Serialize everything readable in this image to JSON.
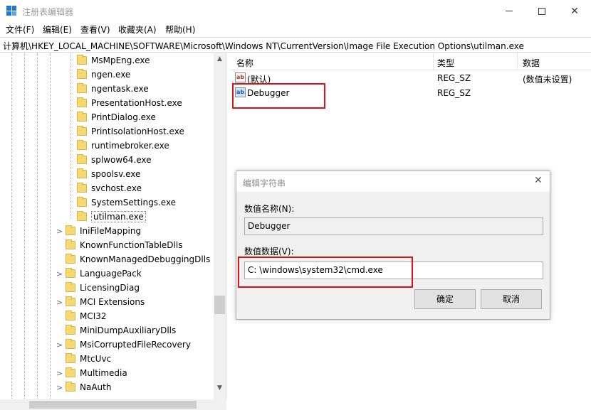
{
  "window": {
    "title": "注册表编辑器",
    "buttons": {
      "minimize": "—",
      "maximize": "☐",
      "close": "✕"
    }
  },
  "menu": [
    "文件(F)",
    "编辑(E)",
    "查看(V)",
    "收藏夹(A)",
    "帮助(H)"
  ],
  "address": "计算机\\HKEY_LOCAL_MACHINE\\SOFTWARE\\Microsoft\\Windows NT\\CurrentVersion\\Image File Execution Options\\utilman.exe",
  "tree": {
    "children": [
      "MsMpEng.exe",
      "ngen.exe",
      "ngentask.exe",
      "PresentationHost.exe",
      "PrintDialog.exe",
      "PrintIsolationHost.exe",
      "runtimebroker.exe",
      "splwow64.exe",
      "spoolsv.exe",
      "svchost.exe",
      "SystemSettings.exe",
      "utilman.exe"
    ],
    "selected": "utilman.exe",
    "siblings": [
      "IniFileMapping",
      "KnownFunctionTableDlls",
      "KnownManagedDebuggingDlls",
      "LanguagePack",
      "LicensingDiag",
      "MCI Extensions",
      "MCI32",
      "MiniDumpAuxiliaryDlls",
      "MsiCorruptedFileRecovery",
      "MtcUvc",
      "Multimedia",
      "NaAuth"
    ]
  },
  "list": {
    "headers": {
      "name": "名称",
      "type": "类型",
      "data": "数据"
    },
    "rows": [
      {
        "name": "(默认)",
        "type": "REG_SZ",
        "data": "(数值未设置)"
      },
      {
        "name": "Debugger",
        "type": "REG_SZ",
        "data": ""
      }
    ]
  },
  "dialog": {
    "title": "编辑字符串",
    "close": "✕",
    "name_label": "数值名称(N):",
    "name_value": "Debugger",
    "data_label": "数值数据(V):",
    "data_value": "C:  \\windows\\system32\\cmd.exe",
    "ok": "确定",
    "cancel": "取消"
  },
  "colors": {
    "highlight": "#e0101a",
    "folder": "#f7d873",
    "app_icon": "#1e7ad6"
  }
}
